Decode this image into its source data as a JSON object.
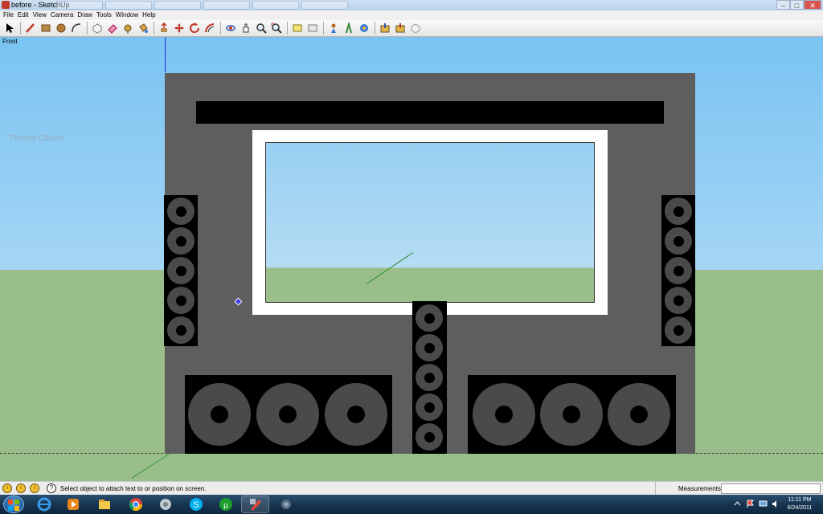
{
  "window": {
    "title": "before - SketchUp",
    "min": "–",
    "max": "□",
    "close": "✕"
  },
  "menu": [
    "File",
    "Edit",
    "View",
    "Camera",
    "Draw",
    "Tools",
    "Window",
    "Help"
  ],
  "viewport": {
    "view_name": "Front",
    "scene_text": "Theater Closed"
  },
  "status": {
    "message": "Select object to attach text to or position on screen.",
    "measurements_label": "Measurements",
    "measurements_value": ""
  },
  "taskbar": {
    "time": "11:11 PM",
    "date": "8/24/2011"
  },
  "colors": {
    "sky": "#79c3f2",
    "ground": "#99be89",
    "wall": "#5e5e5e",
    "speaker": "#000000",
    "driver": "#4a4a4a"
  }
}
